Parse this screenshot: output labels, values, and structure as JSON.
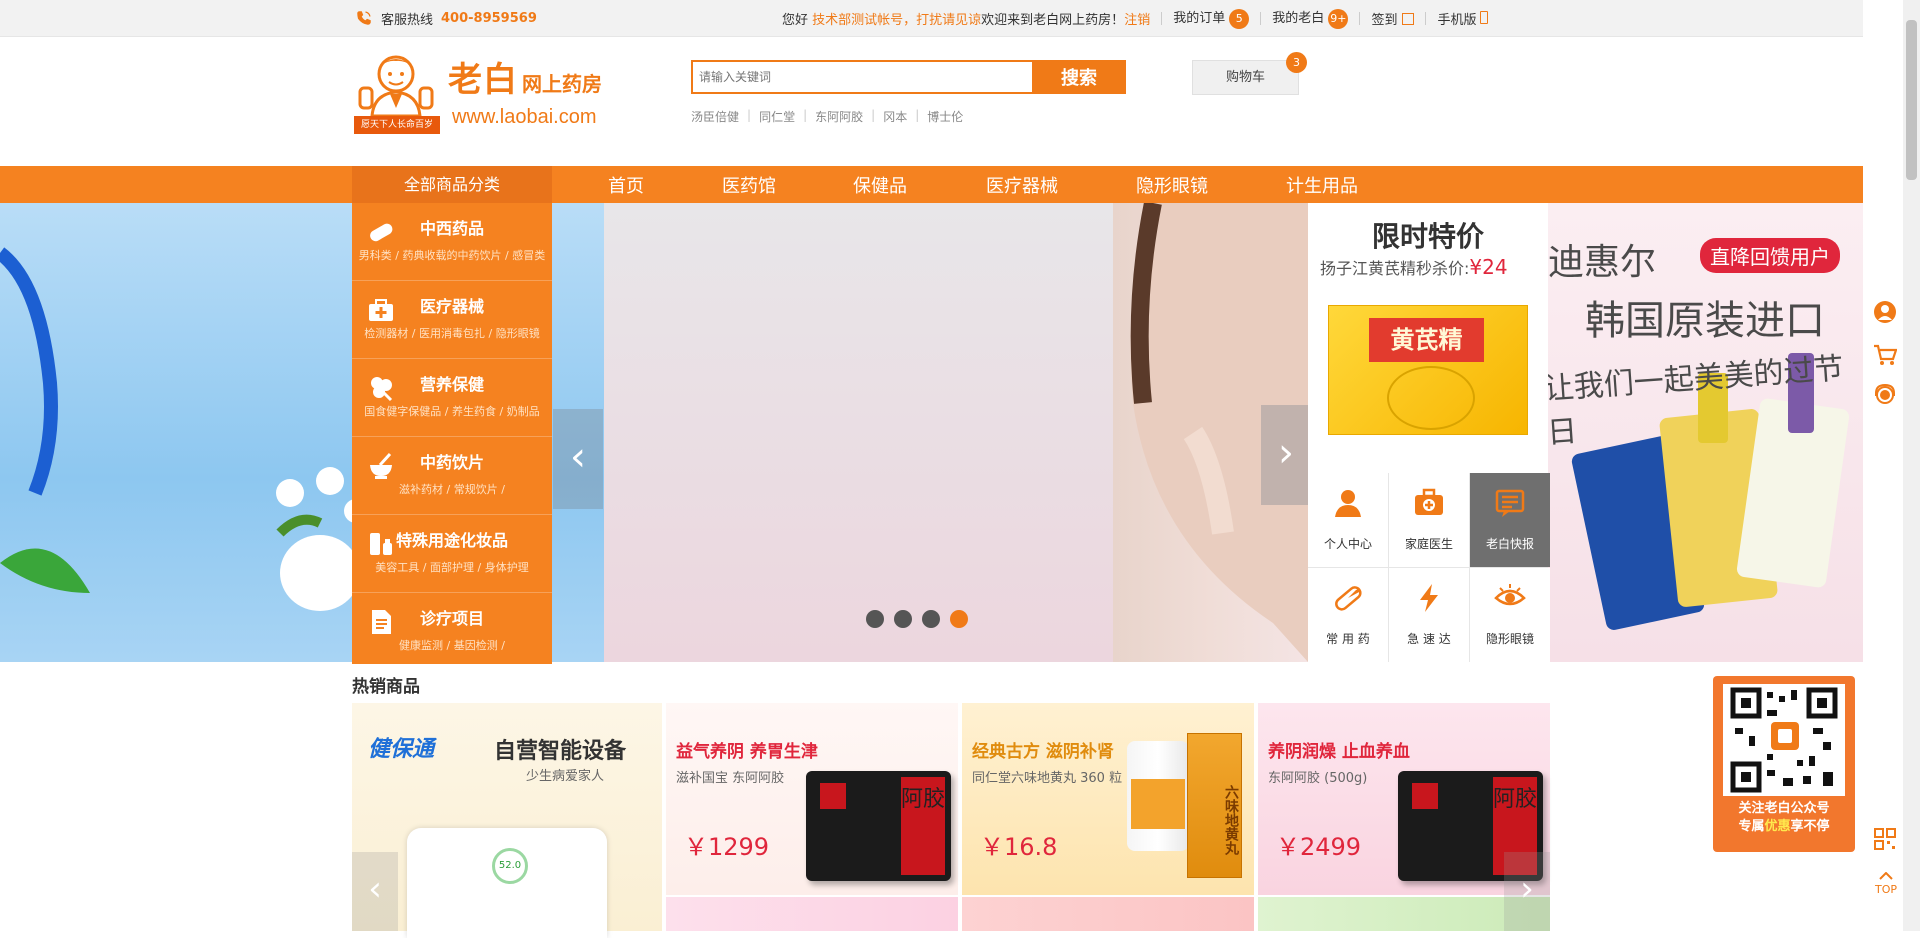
{
  "topbar": {
    "hotline_label": "客服热线",
    "hotline_number": "400-8959569",
    "greeting": "您好",
    "account_name": "技术部测试帐号，打扰请见谅",
    "welcome": "欢迎来到老白网上药房！",
    "logout": "注销",
    "my_orders": "我的订单",
    "my_orders_count": "5",
    "my_laobai": "我的老白",
    "my_laobai_count": "9+",
    "checkin": "签到",
    "mobile": "手机版"
  },
  "logo": {
    "name": "老白",
    "subtitle": "网上药房",
    "url": "www.laobai.com",
    "slogan": "愿天下人长命百岁"
  },
  "search": {
    "placeholder": "请输入关键词",
    "button": "搜索",
    "hot_words": [
      "汤臣倍健",
      "同仁堂",
      "东阿阿胶",
      "冈本",
      "博士伦"
    ]
  },
  "cart": {
    "label": "购物车",
    "count": "3"
  },
  "nav": {
    "all_categories": "全部商品分类",
    "items": [
      "首页",
      "医药馆",
      "保健品",
      "医疗器械",
      "隐形眼镜",
      "计生用品"
    ]
  },
  "categories": [
    {
      "title": "中西药品",
      "sub": "男科类 / 药典收载的中药饮片 / 感冒类"
    },
    {
      "title": "医疗器械",
      "sub": "检测器材 / 医用消毒包扎 / 隐形眼镜"
    },
    {
      "title": "营养保健",
      "sub": "国食健字保健品 / 养生药食 / 奶制品"
    },
    {
      "title": "中药饮片",
      "sub": "滋补药材 / 常规饮片 /"
    },
    {
      "title": "特殊用途化妆品",
      "sub": "美容工具 / 面部护理 / 身体护理"
    },
    {
      "title": "诊疗项目",
      "sub": "健康监测 / 基因检测 /"
    }
  ],
  "banner": {
    "title1": "迪惠尔",
    "tag": "直降回馈用户",
    "title2": "韩国原装进口",
    "title3": "让我们一起美美的过节日"
  },
  "special": {
    "title": "限时特价",
    "product": "扬子江黄芪精秒杀价:",
    "price": "¥24",
    "box_label": "黄芪精"
  },
  "quick_links": [
    "个人中心",
    "家庭医生",
    "老白快报",
    "常 用 药",
    "急 速 达",
    "隐形眼镜"
  ],
  "hot": {
    "title": "热销商品",
    "promo": {
      "brand": "健保通",
      "headline": "自营智能设备",
      "sub": "少生病爱家人",
      "display": "52.0"
    },
    "products": [
      {
        "title": "益气养阴 养胃生津",
        "sub": "滋补国宝  东阿阿胶",
        "price": "￥1299",
        "box": "阿胶"
      },
      {
        "title": "经典古方 滋阴补肾",
        "sub": "同仁堂六味地黄丸 360 粒",
        "price": "￥16.8",
        "box": "六味地黄丸"
      },
      {
        "title": "养阴润燥 止血养血",
        "sub": "东阿阿胶 (500g)",
        "price": "￥2499",
        "box": "阿胶"
      }
    ]
  },
  "qr": {
    "line1": "关注老白公众号",
    "line2_a": "专属",
    "line2_b": "优惠",
    "line2_c": "享不停"
  },
  "top_button": "TOP",
  "colors": {
    "brand_orange": "#f58220",
    "price_red": "#e0263c"
  }
}
